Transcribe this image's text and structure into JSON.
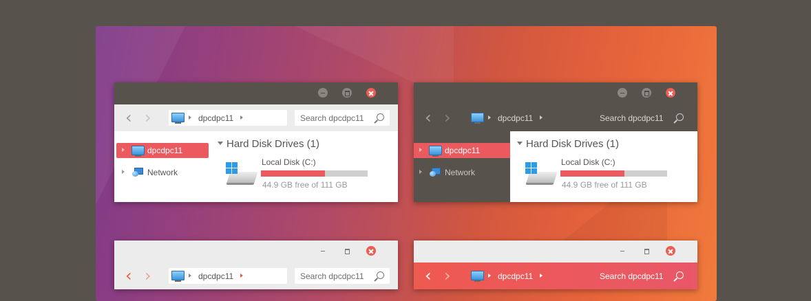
{
  "windows": [
    {
      "address": "dpcdpc11",
      "search_placeholder": "Search dpcdpc11",
      "sidebar": {
        "selected": "dpcdpc11",
        "network": "Network"
      },
      "group": "Hard Disk Drives (1)",
      "disk": {
        "name": "Local Disk (C:)",
        "free_text": "44.9 GB free of 111 GB",
        "used_fraction": 0.6
      }
    },
    {
      "address": "dpcdpc11",
      "search_placeholder": "Search dpcdpc11",
      "sidebar": {
        "selected": "dpcdpc11",
        "network": "Network"
      },
      "group": "Hard Disk Drives (1)",
      "disk": {
        "name": "Local Disk (C:)",
        "free_text": "44.9 GB free of 111 GB",
        "used_fraction": 0.6
      }
    },
    {
      "address": "dpcdpc11",
      "search_placeholder": "Search dpcdpc11"
    },
    {
      "address": "dpcdpc11",
      "search_placeholder": "Search dpcdpc11"
    }
  ],
  "icons": {
    "back": "chevron-left-icon",
    "forward": "chevron-right-icon",
    "computer": "computer-icon",
    "network": "network-icon",
    "search": "search-icon",
    "drive": "hard-drive-icon",
    "minimize": "minimize-icon",
    "maximize": "maximize-icon",
    "close": "close-icon"
  },
  "colors": {
    "accent": "#ea5a5e",
    "background": "#57524c",
    "window_bg": "#ececec",
    "close": "#e95f56"
  }
}
